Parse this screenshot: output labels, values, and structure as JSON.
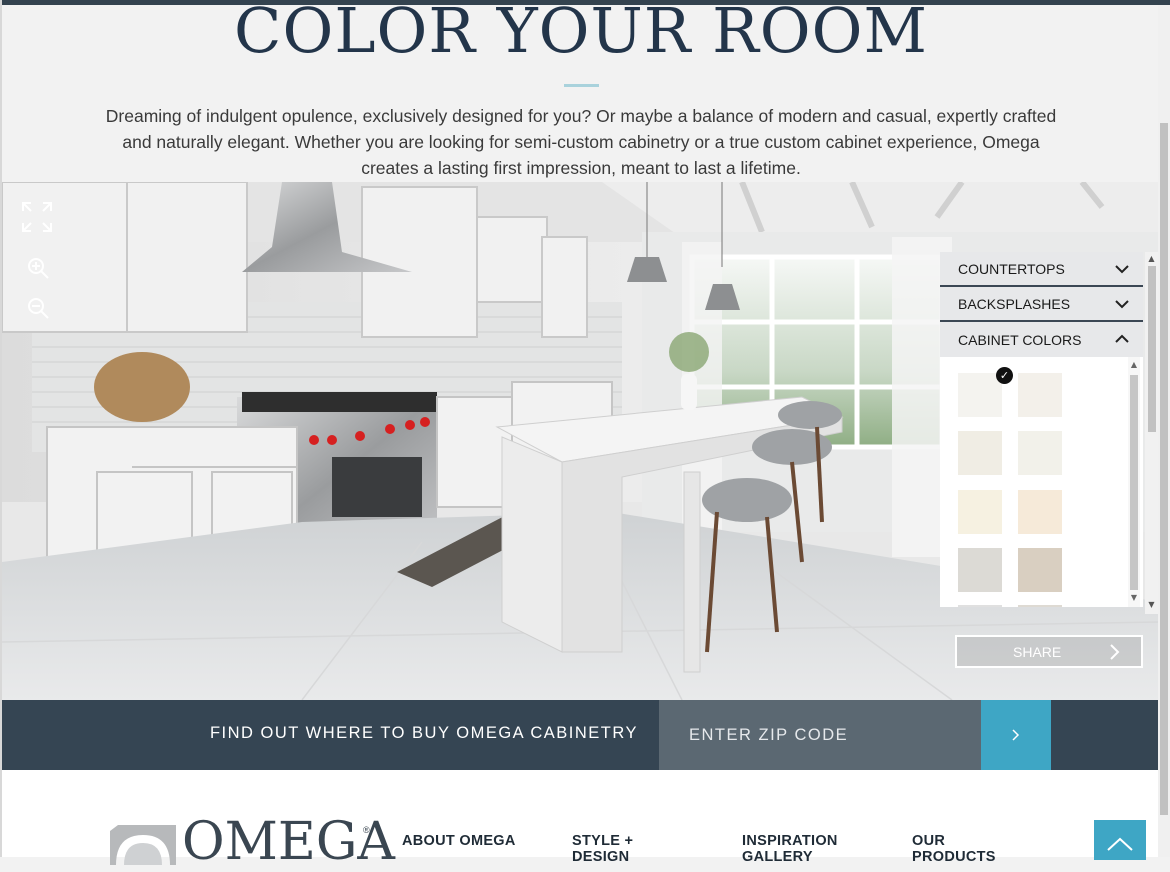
{
  "page": {
    "title": "COLOR YOUR ROOM",
    "intro": "Dreaming of indulgent opulence, exclusively designed for you? Or maybe a balance of modern and casual, expertly crafted and naturally elegant. Whether you are looking for semi-custom cabinetry or a true custom cabinet experience, Omega creates a lasting first impression, meant to last a lifetime."
  },
  "visualizer": {
    "tools": [
      {
        "icon": "fullscreen-icon"
      },
      {
        "icon": "zoom-in-icon"
      },
      {
        "icon": "zoom-out-icon"
      }
    ],
    "panel": {
      "sections": [
        {
          "label": "COUNTERTOPS",
          "state": "collapsed",
          "icon": "chevron-down-icon"
        },
        {
          "label": "BACKSPLASHES",
          "state": "collapsed",
          "icon": "chevron-down-icon"
        },
        {
          "label": "CABINET COLORS",
          "state": "expanded",
          "icon": "chevron-up-icon"
        }
      ],
      "swatches": [
        {
          "color": "#f4f3ef",
          "selected": true
        },
        {
          "color": "#f3f0ea",
          "selected": false
        },
        {
          "color": "#f0ede4",
          "selected": false
        },
        {
          "color": "#f2f1ea",
          "selected": false
        },
        {
          "color": "#f6f1e1",
          "selected": false
        },
        {
          "color": "#f6ead9",
          "selected": false
        },
        {
          "color": "#dcdad5",
          "selected": false
        },
        {
          "color": "#d9cfc1",
          "selected": false
        }
      ],
      "selected_icon": "checkmark-icon"
    },
    "share": {
      "label": "SHARE",
      "icon": "chevron-right-icon"
    }
  },
  "buy_bar": {
    "label": "FIND OUT WHERE TO BUY OMEGA CABINETRY",
    "zip_placeholder": "ENTER ZIP CODE",
    "submit_icon": "chevron-right-icon"
  },
  "footer": {
    "logo_text": "OMEGA",
    "logo_mark": "®",
    "links": [
      "ABOUT OMEGA",
      "STYLE + DESIGN",
      "INSPIRATION GALLERY",
      "OUR PRODUCTS"
    ],
    "back_to_top_icon": "chevron-up-icon"
  },
  "colors": {
    "navy": "#354553",
    "accent": "#3ea6c5",
    "zip_field": "#5b6872",
    "title": "#23354a"
  }
}
